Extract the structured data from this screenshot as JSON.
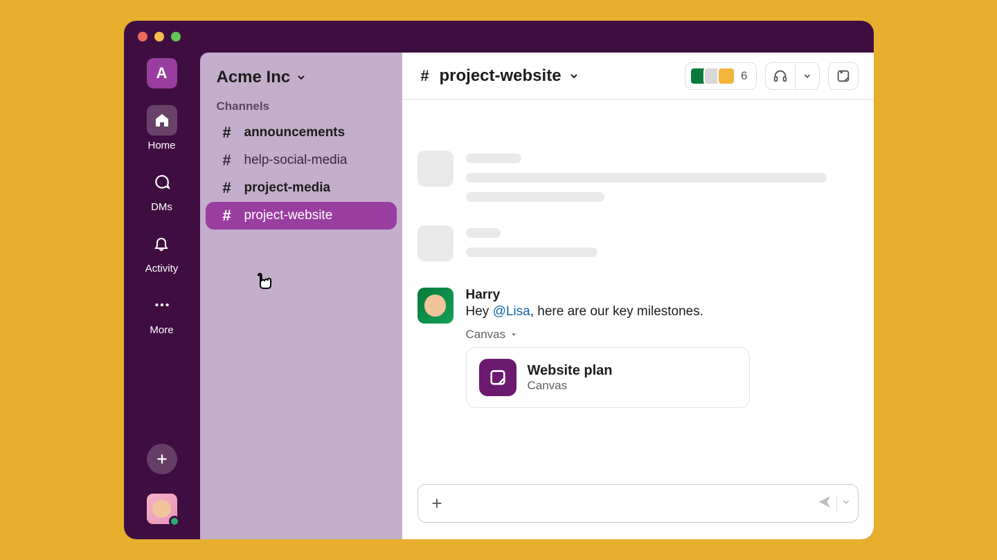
{
  "workspace": {
    "badgeLetter": "A",
    "name": "Acme Inc"
  },
  "rail": {
    "home": "Home",
    "dms": "DMs",
    "activity": "Activity",
    "more": "More"
  },
  "sidebar": {
    "sectionLabel": "Channels",
    "channels": [
      {
        "name": "announcements",
        "bold": true
      },
      {
        "name": "help-social-media",
        "bold": false
      },
      {
        "name": "project-media",
        "bold": true
      },
      {
        "name": "project-website",
        "bold": false,
        "selected": true
      }
    ]
  },
  "channelHeader": {
    "name": "project-website",
    "memberCount": "6"
  },
  "message": {
    "author": "Harry",
    "textPrefix": "Hey ",
    "mention": "@Lisa",
    "textSuffix": ", here are our key milestones."
  },
  "attachment": {
    "label": "Canvas",
    "title": "Website plan",
    "subtitle": "Canvas"
  }
}
